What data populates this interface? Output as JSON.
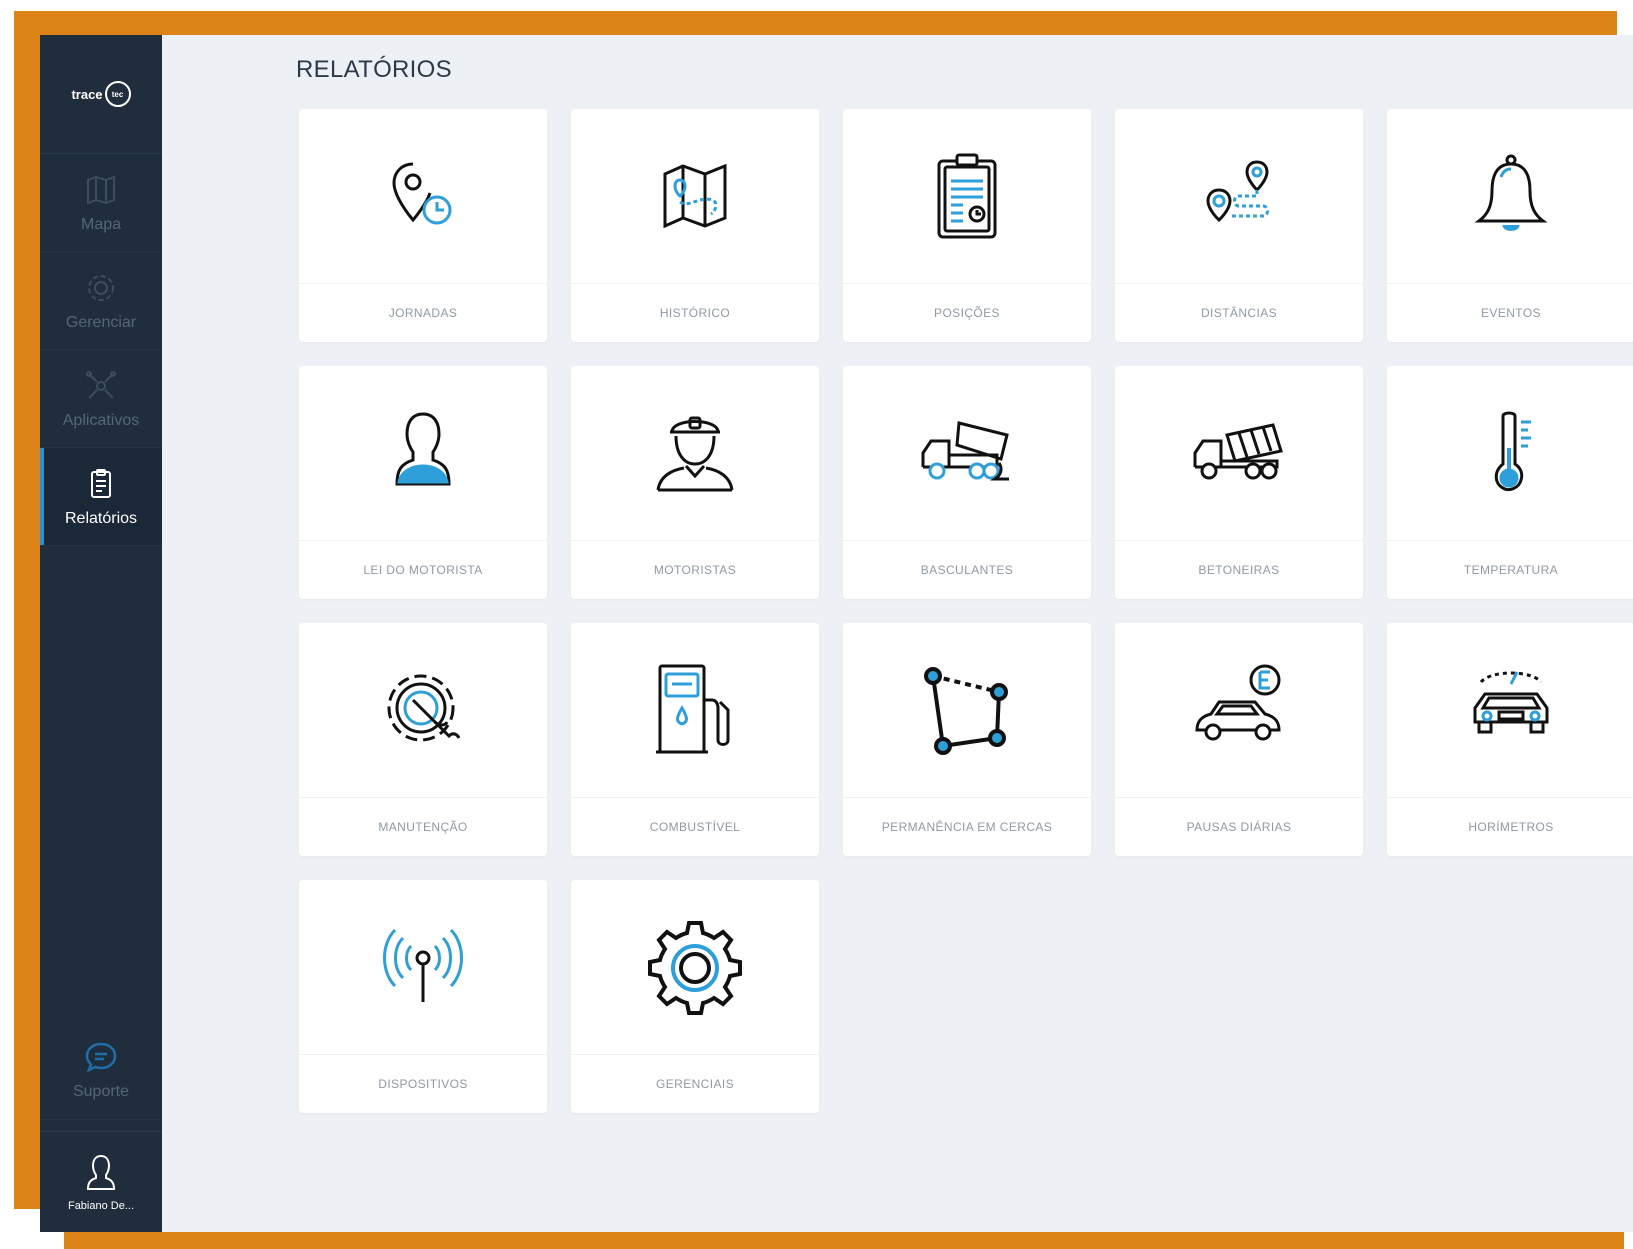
{
  "app": {
    "logo_text": "trace",
    "logo_badge": "tec"
  },
  "sidebar": {
    "items": [
      {
        "label": "Mapa",
        "icon": "map-icon",
        "active": false
      },
      {
        "label": "Gerenciar",
        "icon": "gear-icon",
        "active": false
      },
      {
        "label": "Aplicativos",
        "icon": "apps-icon",
        "active": false
      },
      {
        "label": "Relatórios",
        "icon": "report-icon",
        "active": true
      }
    ],
    "support_label": "Suporte",
    "user_name": "Fabiano De..."
  },
  "main": {
    "title": "RELATÓRIOS",
    "reports": [
      {
        "label": "JORNADAS",
        "icon": "location-clock-icon"
      },
      {
        "label": "HISTÓRICO",
        "icon": "map-route-icon"
      },
      {
        "label": "POSIÇÕES",
        "icon": "clipboard-icon"
      },
      {
        "label": "DISTÂNCIAS",
        "icon": "distance-pins-icon"
      },
      {
        "label": "EVENTOS",
        "icon": "bell-icon"
      },
      {
        "label": "LEI DO MOTORISTA",
        "icon": "person-icon"
      },
      {
        "label": "MOTORISTAS",
        "icon": "driver-icon"
      },
      {
        "label": "BASCULANTES",
        "icon": "dump-truck-icon"
      },
      {
        "label": "BETONEIRAS",
        "icon": "cement-mixer-icon"
      },
      {
        "label": "TEMPERATURA",
        "icon": "thermometer-icon"
      },
      {
        "label": "MANUTENÇÃO",
        "icon": "maintenance-gear-icon"
      },
      {
        "label": "COMBUSTÍVEL",
        "icon": "fuel-pump-icon"
      },
      {
        "label": "PERMANÊNCIA EM CERCAS",
        "icon": "polygon-fence-icon"
      },
      {
        "label": "PAUSAS DIÁRIAS",
        "icon": "car-parking-icon"
      },
      {
        "label": "HORÍMETROS",
        "icon": "car-gauge-icon"
      },
      {
        "label": "DISPOSITIVOS",
        "icon": "antenna-icon"
      },
      {
        "label": "GERENCIAIS",
        "icon": "gear-icon"
      }
    ]
  },
  "colors": {
    "accent_frame": "#dc8418",
    "sidebar_bg": "#1f2d3d",
    "active_indicator": "#2b8fd9",
    "icon_blue": "#2e9fd8",
    "page_bg": "#edf1f6"
  }
}
